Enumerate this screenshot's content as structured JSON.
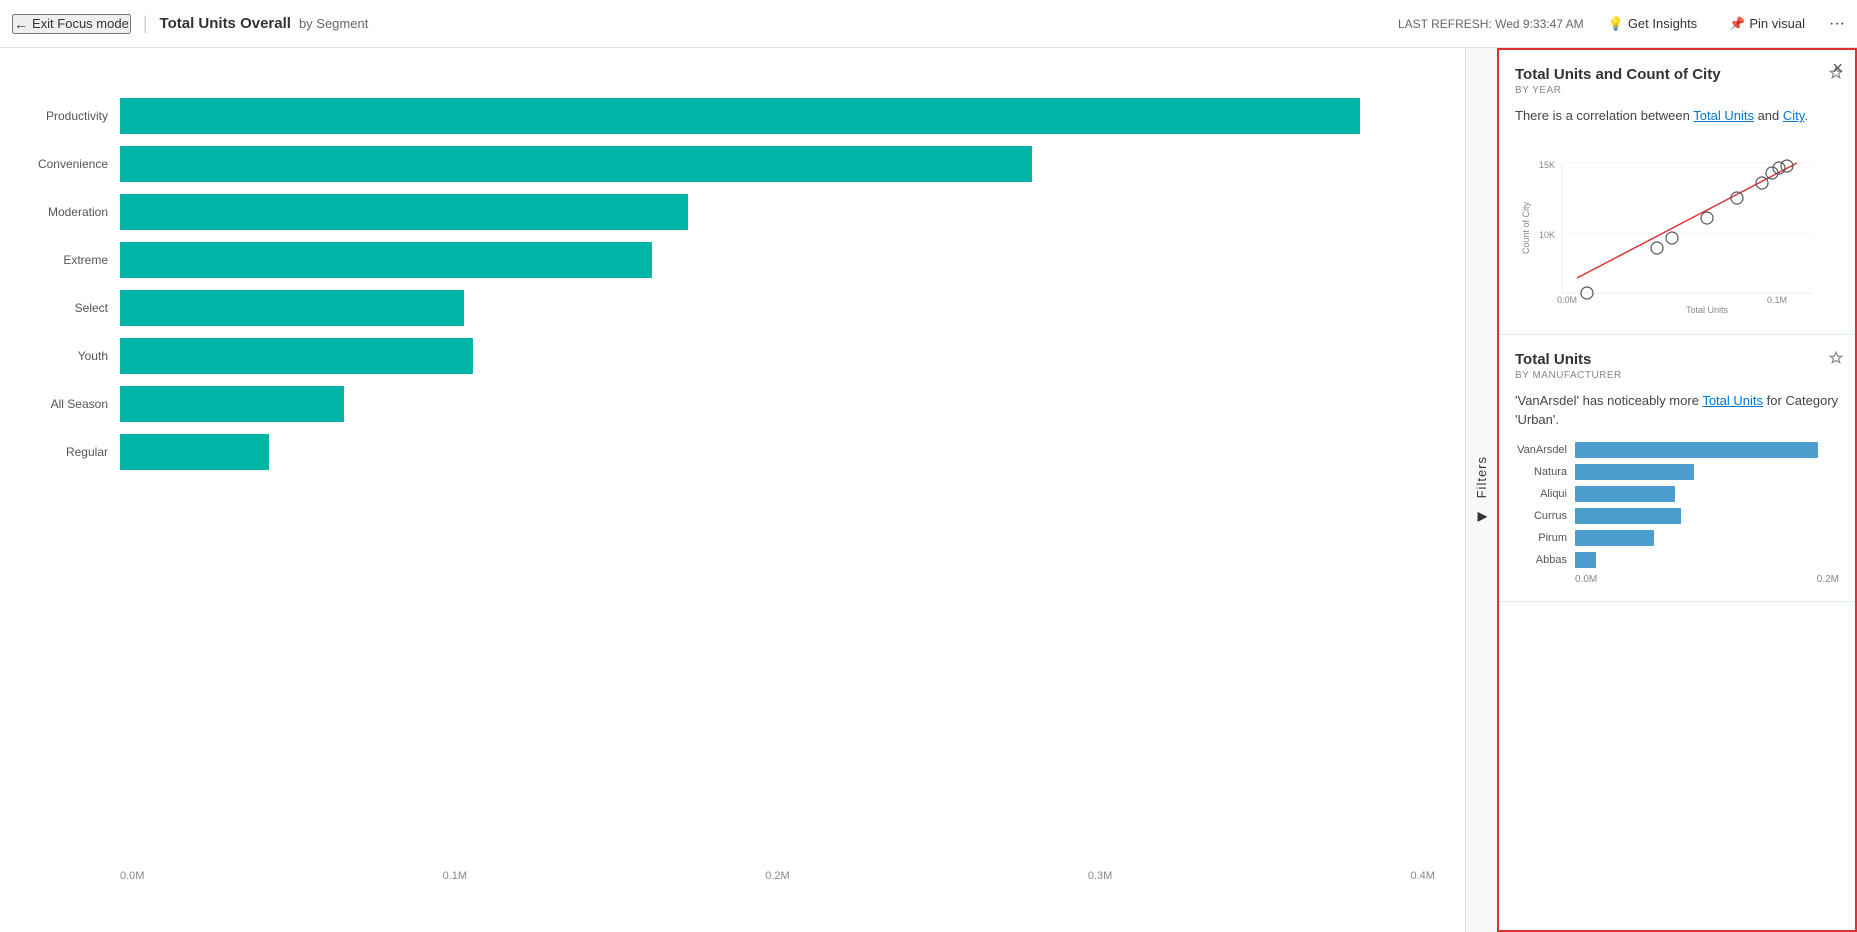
{
  "header": {
    "exit_focus_label": "Exit Focus mode",
    "title": "Total Units Overall",
    "subtitle": "by Segment",
    "last_refresh_label": "LAST REFRESH:",
    "last_refresh_time": "Wed 9:33:47 AM",
    "get_insights_label": "Get Insights",
    "pin_visual_label": "Pin visual",
    "more_icon": "···"
  },
  "filters": {
    "label": "Filters"
  },
  "chart": {
    "title": "Total Units Overall by Segment",
    "bars": [
      {
        "label": "Productivity",
        "value": 0.415,
        "max": 0.44
      },
      {
        "label": "Convenience",
        "value": 0.305,
        "max": 0.44
      },
      {
        "label": "Moderation",
        "value": 0.19,
        "max": 0.44
      },
      {
        "label": "Extreme",
        "value": 0.178,
        "max": 0.44
      },
      {
        "label": "Select",
        "value": 0.115,
        "max": 0.44
      },
      {
        "label": "Youth",
        "value": 0.118,
        "max": 0.44
      },
      {
        "label": "All Season",
        "value": 0.075,
        "max": 0.44
      },
      {
        "label": "Regular",
        "value": 0.05,
        "max": 0.44
      }
    ],
    "x_ticks": [
      "0.0M",
      "0.1M",
      "0.2M",
      "0.3M",
      "0.4M"
    ]
  },
  "insights_panel": {
    "close_icon": "×",
    "card1": {
      "title": "Total Units and Count of City",
      "subtitle": "BY YEAR",
      "description_prefix": "There is a correlation between ",
      "highlight1": "Total Units",
      "description_mid": " and ",
      "highlight2": "City",
      "description_suffix": ".",
      "pin_icon": "📌"
    },
    "card2": {
      "title": "Total Units",
      "subtitle": "BY MANUFACTURER",
      "description": "'VanArsdel' has noticeably more Total Units for Category 'Urban'.",
      "pin_icon": "📌",
      "bars": [
        {
          "label": "VanArsdel",
          "value": 0.92
        },
        {
          "label": "Natura",
          "value": 0.45
        },
        {
          "label": "Aliqui",
          "value": 0.38
        },
        {
          "label": "Currus",
          "value": 0.4
        },
        {
          "label": "Pirum",
          "value": 0.3
        },
        {
          "label": "Abbas",
          "value": 0.08
        }
      ],
      "x_ticks": [
        "0.0M",
        "0.2M"
      ]
    }
  }
}
